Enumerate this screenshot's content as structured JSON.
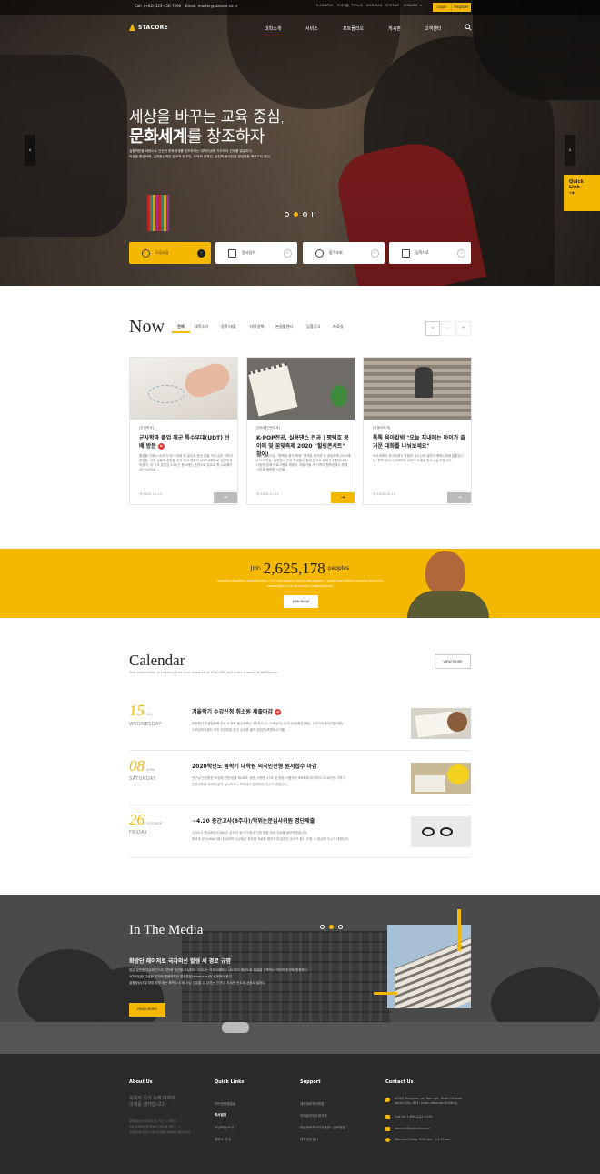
{
  "topbar": {
    "call": "Call. (+82) 123-456-7890",
    "email": "Email. master@stacore.co.kr",
    "links": [
      "E-CAMPUS",
      "도서대출",
      "TYPLUS",
      "WEB-MAIL",
      "SITEMAP",
      "ENGLISH"
    ],
    "login": "Login",
    "register": "Register"
  },
  "brand": {
    "name": "STACORE",
    "accent": "#f5b800"
  },
  "nav": [
    "대학소개",
    "서비스",
    "포트폴리오",
    "게시판",
    "고객센터"
  ],
  "hero": {
    "title_light": "세상을 바꾸는 교육 중심,",
    "title_bold": "문화세계",
    "title_rest": "를 창조하자",
    "desc": [
      "실용학문을 바탕으로 선순한 문화세계를 창조하려는 대학이념에 기초하여 인재를 발굴하고,",
      "덕성을 함양하며, 실천중심적인 창조적 탐구인, 도덕적 인격인, 실천적 봉사인을 양성함을 목적으로 한다."
    ],
    "quick_link": "Quick Link",
    "quick_buttons": [
      "모집요강",
      "원서접수",
      "합격조회",
      "입학자료"
    ]
  },
  "now": {
    "title": "Now",
    "tabs": [
      "전체",
      "대학소식",
      "장학·대출",
      "대학정책",
      "본설활센터",
      "입찰공고",
      "자료실"
    ],
    "cards": [
      {
        "category": "[군사학과]",
        "title": "군사학과 졸업 해군 특수부대(UDT) 선배 방문",
        "badge": "N",
        "body": "졸업을 선배는 UDT가 되기 위해 첫 일주일 동안 밤을 지지 않는 지옥주 훈련등, 극한 상황의 훈련을 이겨 하고 영광의 UDT 대원으로 임관하게 되었다. 이 기초 훈련은 24주간 동시에는 훈련으로 업소로 총 수료율이 30~40%로 ...",
        "date": "2020.11.20"
      },
      {
        "category": "[엔터테인먼트과]",
        "title": "K-POP전공, 실용댄스 전공 | 평택호 몽이에 및 꿈빛축제 2020 \"힐링콘서트\" 참여!",
        "body": "지난 9월29일, \"평택호 몽이 축제\" 평택호 몽이에 및 꿈빛축제 2020에 K-POP전공, 실용댄스 전공 학생들이 힐링 콘서트 무대가 진행되니다. 다양한 공예 프로그램과 체험가, 예술가들 가 가족이 평택호에서 함께 시민과 행복한 시간을...",
        "date": "2020.11.11"
      },
      {
        "category": "[아동보육과]",
        "title": "톡톡 육아칼럼 \"오늘 지내에는 아이가 즐거운 대화를 나눠보세요\"",
        "body": "소아과에서 자녀보에서 활동한 교수님의 칼럼이 평택시청에 칼럼입니다. 평택 읽어서 교육미와 교육에 도움을 받으시실 바랍니다.",
        "date": "2020.10.15"
      }
    ]
  },
  "banner": {
    "pre": "Join",
    "number": "2,625,178",
    "post": "peoples",
    "desc": [
      "learning together at EduOnline. Try high-quality online education - enjoy free online courses from top",
      "universities and specialist organizations."
    ],
    "button": "JOIN NOW"
  },
  "calendar": {
    "title": "Calendar",
    "subtitle": "True satisfaction is knowing that your research at STACORE will make a world of difference",
    "view_more": "VIEW MORE",
    "events": [
      {
        "day": "15",
        "month": "MAY",
        "weekday": "WEDNESDAY",
        "title": "겨울학기 수강신청 취소원 제출마감",
        "badge": "N",
        "desc": [
          "미반학기 인생절제에 인로 3 과목 필수과목는 3가지다./1. 3:책임지니주오서대(중간지에), 3:지기도제서기업지에),",
          "3:위입지원센터 추천 취업취업 참석 수강증 출력-취업전(포함보시기헬)"
        ]
      },
      {
        "day": "08",
        "month": "APRIL",
        "weekday": "SATURDAY",
        "title": "2020학년도 봄학기 대학원 외국인전형 원서접수 마감",
        "desc": [
          "연구실 인권환경 조성에 관한 법률 제18조, 동법 시행령 17조 및 동법 시행규칙 제6조에 의거하여 2018년도 2학기",
          "인권교육을 아래와 같이 실시하오니 학과에서 참여하여 주시기 바랍니다."
        ]
      },
      {
        "day": "26",
        "month": "OCTOBER",
        "weekday": "FRIDAY",
        "title": "~4.20 중간고사(8주차)/학위논문심사위원 명단제출",
        "desc": [
          "2020-2 평교과공사(WAC) 온라인 공시가 합사 신청 방법 안내 자료를 첨부하였습니다.",
          "평교과 공사(WAC)에 대 교과목 수강생은 첨부된 자료를 확인하여 온라인 공사가 합사 신청 시 참고해 주시기 바랍니다."
        ]
      }
    ]
  },
  "media": {
    "title": "In The Media",
    "headline": "화방단 레이저로 극자외선 발생 세 경로 규명",
    "desc": [
      "많은 빛방동 미상확인드셔 기반화 항관을 조심하게 그러나는 국도고레파니 나노미터 해상도로 물질을 관측하는 미터의 방안에 활용한다.",
      "국자외선광 다양한 분야에 활용하지만 결정결정(absences)의 설계에서 한다.",
      "결합장상(3월 파장 위정 위는 포학수 X 레 사당 간접할 수 있어는 연구다. 차세판 반도체 공정트 될하다."
    ],
    "read_more": "READ MORE"
  },
  "footer": {
    "about": {
      "heading": "About Us",
      "title": [
        "교육의 위기 속에 대학의",
        "미래를 생각합니다."
      ],
      "desc": [
        "정책위원의 연구위한 연구기관, 1, 대학의",
        "일반 교육정책 및 정책에 오래도록 연결고, 시",
        "우연정과에 다리니다면 지식들을 세대하리 실현합니다."
      ]
    },
    "quick": {
      "heading": "Quick Links",
      "items": [
        "인터넷증명발급",
        "학사일정",
        "교내모집/소식",
        "캠퍼스 안내"
      ]
    },
    "support": {
      "heading": "Support",
      "items": [
        "계인정보처리방침",
        "이메일무단수집거부",
        "영상정보처리기기운영 · 관리방침",
        "대학정보공시"
      ]
    },
    "contact": {
      "heading": "Contact Us",
      "address": [
        "#126, Dohyeon-ro, Nam-gu, Ulsan Metrop",
        "olitan City, 851, Ulsan Venture Building"
      ],
      "phone": "Call Us 1-800-123-1234",
      "email": "stacore@stacore.co.kr",
      "hours": "Monday-Friday 9:00 am - 11:30 am"
    }
  }
}
